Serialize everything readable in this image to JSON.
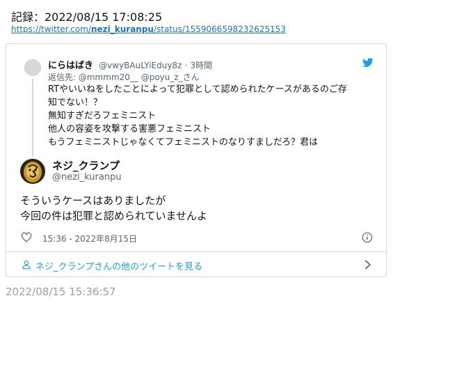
{
  "record": {
    "label": "記録：2022/08/15 17:08:25"
  },
  "url": {
    "prefix": "https://twitter.com/",
    "user": "nezi_kuranpu",
    "suffix": "/status/1559066598232625153"
  },
  "reply_tweet": {
    "name": "にらはばき",
    "handle": "@vwyBAuLYiEduy8z",
    "separator": "·",
    "time": "3時間",
    "reply_to": "返信先: @mmmm20__ @poyu_z_さん",
    "lines": [
      "RTやいいねをしたことによって犯罪として認められたケースがあるのご存",
      "知でない！？",
      "無知すぎだろフェミニスト",
      "他人の容姿を攻撃する害悪フェミニスト",
      "もうフェミニストじゃなくてフェミニストのなりすましだろ？君は"
    ]
  },
  "main_tweet": {
    "name": "ネジ_クランプ",
    "handle": "@nezi_kuranpu",
    "lines": [
      "そういうケースはありましたが",
      "今回の件は犯罪と認められていませんよ"
    ],
    "timestamp": "15:36 - 2022年8月15日"
  },
  "more_link": {
    "label": "ネジ_クランプさんの他のツイートを見る"
  },
  "archive_time": "2022/08/15 15:36:57",
  "colors": {
    "link": "#1a73c7",
    "twitter_blue": "#1d9bf0",
    "muted": "#536471",
    "border": "#cfd9de"
  },
  "icons": [
    "twitter-bird-icon",
    "heart-icon",
    "info-icon",
    "person-icon",
    "chevron-right-icon"
  ]
}
